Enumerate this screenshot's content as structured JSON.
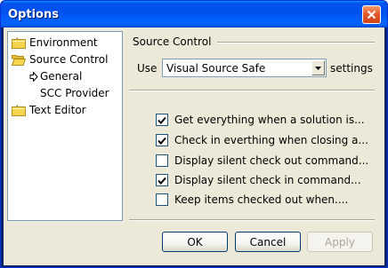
{
  "window": {
    "title": "Options"
  },
  "tree": {
    "items": [
      {
        "label": "Environment"
      },
      {
        "label": "Source Control"
      },
      {
        "label": "General"
      },
      {
        "label": "SCC Provider"
      },
      {
        "label": "Text Editor"
      }
    ]
  },
  "panel": {
    "section_title": "Source Control",
    "use_label": "Use",
    "provider_select": {
      "value": "Visual Source Safe"
    },
    "settings_label": "settings",
    "options": [
      {
        "label": "Get everything when a solution is...",
        "checked": true
      },
      {
        "label": "Check in everthing when closing a...",
        "checked": true
      },
      {
        "label": "Display silent check out command...",
        "checked": false
      },
      {
        "label": "Display silent check in command...",
        "checked": true
      },
      {
        "label": "Keep items checked out when....",
        "checked": false
      }
    ]
  },
  "buttons": {
    "ok": "OK",
    "cancel": "Cancel",
    "apply": "Apply",
    "apply_enabled": false
  },
  "colors": {
    "titlebar": "#0053ee",
    "client": "#ece9d8",
    "close": "#e45b2a",
    "folder": "#f5d54e"
  },
  "icons": {
    "close": "close-icon",
    "folder": "folder-icon",
    "open_folder": "open-folder-icon",
    "arrow": "arrow-right-icon",
    "dropdown": "chevron-down-icon",
    "check": "check-icon"
  }
}
